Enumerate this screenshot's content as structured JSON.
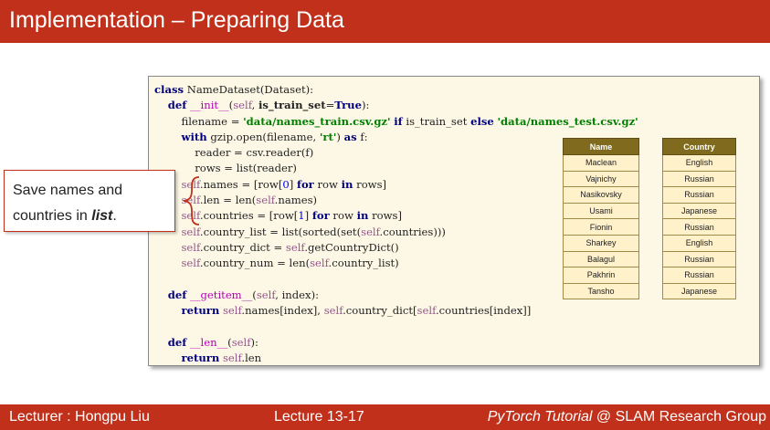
{
  "slide": {
    "title": "Implementation – Preparing Data"
  },
  "callout": {
    "line1": "Save names and",
    "line2_prefix": "countries in ",
    "line2_emphasis": "list",
    "line2_suffix": "."
  },
  "tables": {
    "names": {
      "header": "Name",
      "rows": [
        "Maclean",
        "Vajnichy",
        "Nasikovsky",
        "Usami",
        "Fionin",
        "Sharkey",
        "Balagul",
        "Pakhrin",
        "Tansho"
      ]
    },
    "countries": {
      "header": "Country",
      "rows": [
        "English",
        "Russian",
        "Russian",
        "Japanese",
        "Russian",
        "English",
        "Russian",
        "Russian",
        "Japanese"
      ]
    }
  },
  "footer": {
    "lecturer": "Lecturer : Hongpu Liu",
    "lecture": "Lecture 13-17",
    "course_italic": "PyTorch Tutorial",
    "course_rest": " @ SLAM Research Group"
  },
  "colors": {
    "accent": "#c0301a",
    "code_background": "#fdf8e6",
    "table_header": "#7f6a1e",
    "table_cell": "#fff1c9"
  }
}
